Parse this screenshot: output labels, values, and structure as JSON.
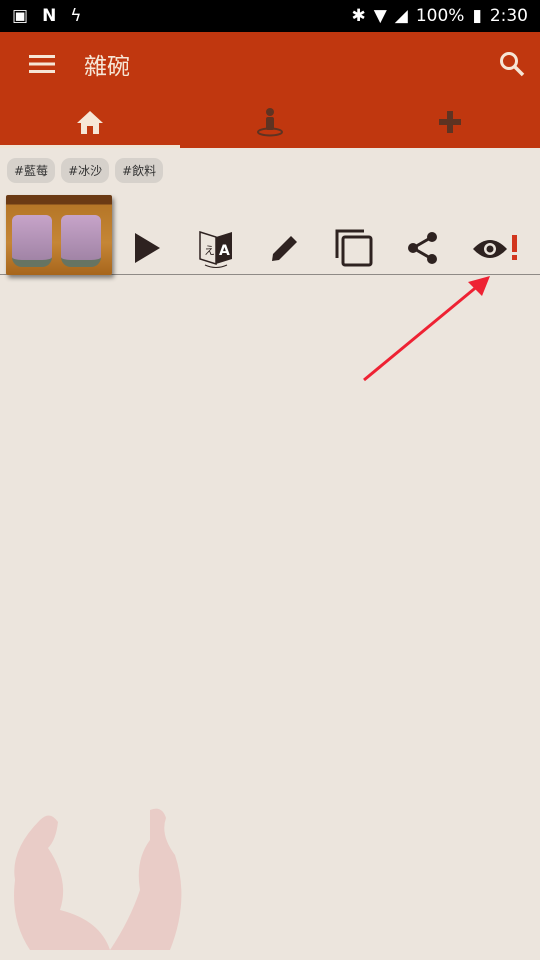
{
  "status_bar": {
    "battery": "100%",
    "time": "2:30"
  },
  "app_bar": {
    "title": "雜碗"
  },
  "tabs": [
    {
      "name": "home"
    },
    {
      "name": "person-pin"
    },
    {
      "name": "add"
    }
  ],
  "tags": [
    "#藍莓",
    "#冰沙",
    "#飲料"
  ],
  "colors": {
    "primary": "#c0370f",
    "background": "#ece5dd",
    "icon": "#3a2a28",
    "alert": "#d2361e",
    "annotation_arrow": "#ee2233"
  }
}
